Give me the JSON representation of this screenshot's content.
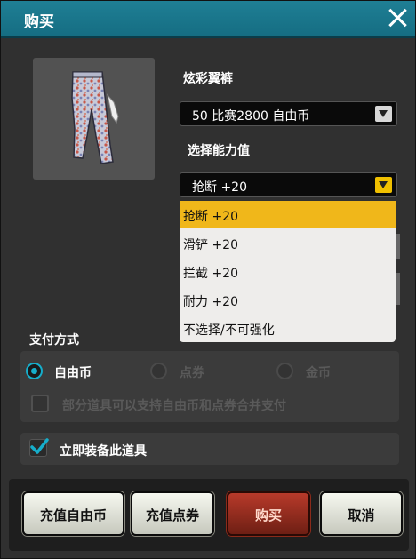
{
  "dialog": {
    "title": "购买"
  },
  "item": {
    "name": "炫彩翼裤",
    "price_selected": "50 比赛2800 自由币",
    "ability_label": "选择能力值",
    "ability_selected": "抢断 +20",
    "ability_options": [
      "抢断 +20",
      "滑铲 +20",
      "拦截 +20",
      "耐力 +20",
      "不选择/不可强化"
    ]
  },
  "payment": {
    "label": "支付方式",
    "options": [
      {
        "label": "自由币",
        "selected": true
      },
      {
        "label": "点券",
        "selected": false
      },
      {
        "label": "金币",
        "selected": false
      }
    ],
    "combine_label": "部分道具可以支持自由币和点券合并支付"
  },
  "equip": {
    "label": "立即装备此道具",
    "checked": true
  },
  "buttons": {
    "recharge_free": "充值自由币",
    "recharge_points": "充值点券",
    "buy": "购买",
    "cancel": "取消"
  },
  "colors": {
    "titlebar": "#1a7a8f",
    "accent": "#16aecb",
    "highlight": "#f0b71a",
    "buy": "#9a2f22"
  }
}
